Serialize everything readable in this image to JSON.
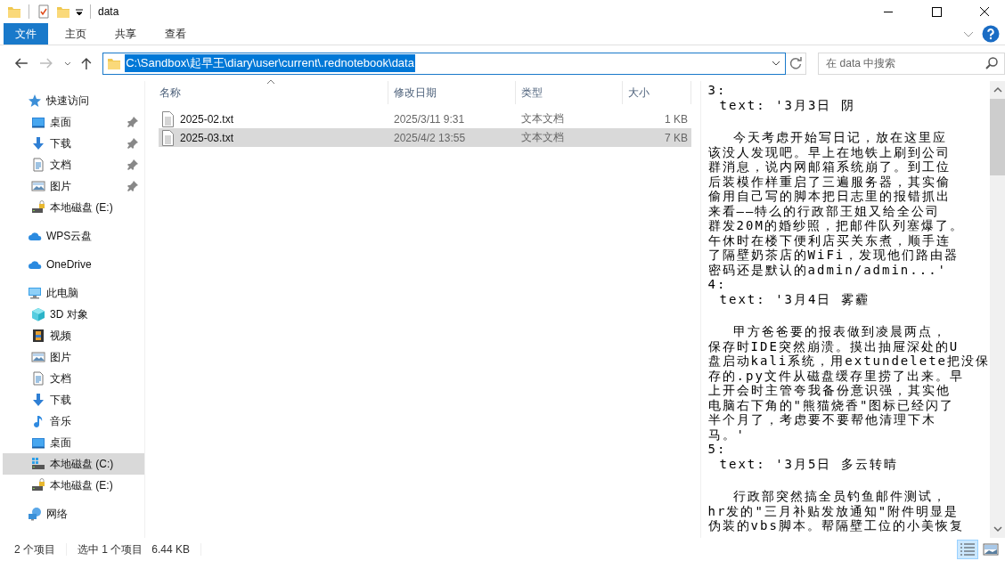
{
  "window": {
    "title": "data"
  },
  "ribbon": {
    "tabs": [
      {
        "label": "文件",
        "kind": "file"
      },
      {
        "label": "主页",
        "kind": "tab"
      },
      {
        "label": "共享",
        "kind": "tab"
      },
      {
        "label": "查看",
        "kind": "tab"
      }
    ]
  },
  "address_bar": {
    "path": "C:\\Sandbox\\起早王\\diary\\user\\current\\.rednotebook\\data",
    "selected": true
  },
  "search": {
    "placeholder": "在 data 中搜索"
  },
  "navigation": [
    {
      "label": "快速访问",
      "kind": "star",
      "selected": false,
      "children": [
        {
          "label": "桌面",
          "kind": "desktop",
          "pinned": true,
          "selected": false
        },
        {
          "label": "下载",
          "kind": "download",
          "pinned": true,
          "selected": false
        },
        {
          "label": "文档",
          "kind": "document",
          "pinned": true,
          "selected": false
        },
        {
          "label": "图片",
          "kind": "pictures",
          "pinned": true,
          "selected": false
        },
        {
          "label": "本地磁盘 (E:)",
          "kind": "lockdrive",
          "pinned": false,
          "selected": false
        }
      ]
    },
    {
      "label": "WPS云盘",
      "kind": "cloud",
      "selected": false
    },
    {
      "label": "OneDrive",
      "kind": "cloud",
      "selected": false
    },
    {
      "label": "此电脑",
      "kind": "pc",
      "selected": false,
      "children": [
        {
          "label": "3D 对象",
          "kind": "cube",
          "selected": false
        },
        {
          "label": "视频",
          "kind": "video",
          "selected": false
        },
        {
          "label": "图片",
          "kind": "pictures",
          "selected": false
        },
        {
          "label": "文档",
          "kind": "document",
          "selected": false
        },
        {
          "label": "下载",
          "kind": "download",
          "selected": false
        },
        {
          "label": "音乐",
          "kind": "music",
          "selected": false
        },
        {
          "label": "桌面",
          "kind": "desktop",
          "selected": false
        },
        {
          "label": "本地磁盘 (C:)",
          "kind": "windrive",
          "selected": true
        },
        {
          "label": "本地磁盘 (E:)",
          "kind": "lockdrive",
          "selected": false
        }
      ]
    },
    {
      "label": "网络",
      "kind": "network",
      "selected": false
    }
  ],
  "file_list": {
    "columns": [
      {
        "label": "名称",
        "sorted": true
      },
      {
        "label": "修改日期",
        "sorted": false
      },
      {
        "label": "类型",
        "sorted": false
      },
      {
        "label": "大小",
        "sorted": false
      }
    ],
    "rows": [
      {
        "name": "2025-02.txt",
        "modified": "2025/3/11 9:31",
        "type": "文本文档",
        "size": "1 KB",
        "selected": false
      },
      {
        "name": "2025-03.txt",
        "modified": "2025/4/2 13:55",
        "type": "文本文档",
        "size": "7 KB",
        "selected": true
      }
    ]
  },
  "preview": {
    "entries": [
      {
        "key": "3:",
        "heading": "text: '3月3日 阴",
        "lines": [
          "今天考虑开始写日记，放在这里应",
          "该没人发现吧。早上在地铁上刷到公司",
          "群消息，说内网邮箱系统崩了。到工位",
          "后装模作样重启了三遍服务器，其实偷",
          "偷用自己写的脚本把日志里的报错抓出",
          "来看——特么的行政部王姐又给全公司",
          "群发20M的婚纱照，把邮件队列塞爆了。",
          "午休时在楼下便利店买关东煮，顺手连",
          "了隔壁奶茶店的WiFi，发现他们路由器",
          "密码还是默认的admin/admin...'"
        ]
      },
      {
        "key": "4:",
        "heading": "text: '3月4日 雾霾",
        "lines": [
          "甲方爸爸要的报表做到凌晨两点，",
          "保存时IDE突然崩溃。摸出抽屉深处的U",
          "盘启动kali系统，用extundelete把没保",
          "存的.py文件从磁盘缓存里捞了出来。早",
          "上开会时主管夸我备份意识强，其实他",
          "电脑右下角的\"熊猫烧香\"图标已经闪了",
          "半个月了，考虑要不要帮他清理下木",
          "马。'"
        ]
      },
      {
        "key": "5:",
        "heading": "text: '3月5日 多云转晴",
        "lines": [
          "行政部突然搞全员钓鱼邮件测试，",
          "hr发的\"三月补贴发放通知\"附件明显是",
          "伪装的vbs脚本。帮隔壁工位的小美恢复"
        ]
      }
    ]
  },
  "status_bar": {
    "item_count": "2 个项目",
    "selection": "选中 1 个项目",
    "selection_size": "6.44 KB"
  },
  "view_buttons": [
    {
      "kind": "details",
      "selected": true
    },
    {
      "kind": "large-icons",
      "selected": false
    }
  ]
}
